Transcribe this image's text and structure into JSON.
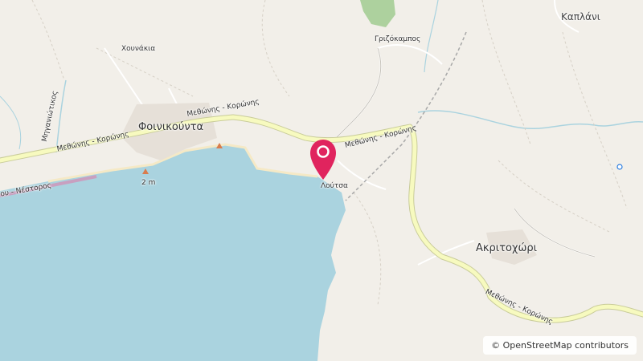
{
  "map": {
    "attribution": "© OpenStreetMap contributors",
    "colors": {
      "land": "#f2efe9",
      "sea": "#aad3df",
      "road": "#f7fabf",
      "road_casing": "#c9cc9a",
      "forest": "#add19e",
      "marker": "#e0245e",
      "river": "#aad3df"
    },
    "labels": {
      "kaplani": "Καπλάνι",
      "grizokampos": "Γριζόκαμπος",
      "chounakia": "Χουνάκια",
      "foinikounta": "Φοινικούντα",
      "loutsa": "Λούτσα",
      "akritochori": "Ακριτοχώρι",
      "mixaniotikos": "Μηγανιώτικος",
      "road_left": "Μεθώνης - Κορώνης",
      "road_center": "Μεθώνης - Κορώνης",
      "road_right": "Μεθώνης - Κορώνης",
      "road_bottom": "Μεθώνης - Κορώνης",
      "nestoros": "ου - Νέστορος",
      "elevation": "2 m"
    },
    "marker_icon": "location-pin-icon"
  }
}
